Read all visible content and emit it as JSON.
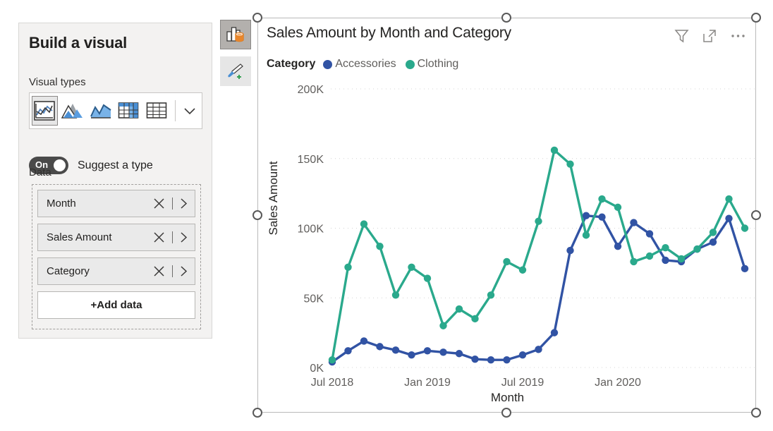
{
  "panel": {
    "title": "Build a visual",
    "visual_types_label": "Visual types",
    "data_label": "Data",
    "visual_types": [
      {
        "name": "line-chart",
        "selected": true
      },
      {
        "name": "area-chart",
        "selected": false
      },
      {
        "name": "line-and-area-chart",
        "selected": false
      },
      {
        "name": "matrix",
        "selected": false
      },
      {
        "name": "table",
        "selected": false
      }
    ],
    "more_types_label": "More visual types",
    "suggest": {
      "state_label": "On",
      "label": "Suggest a type",
      "enabled": true
    },
    "fields": [
      {
        "name": "Month"
      },
      {
        "name": "Sales Amount"
      },
      {
        "name": "Category"
      }
    ],
    "add_data_label": "+Add data"
  },
  "toolbar": {
    "build_visual_label": "Build visual",
    "format_visual_label": "Format visual"
  },
  "visual": {
    "title": "Sales Amount by Month and Category",
    "actions": [
      {
        "name": "filter-icon"
      },
      {
        "name": "focus-mode-icon"
      },
      {
        "name": "more-options-icon"
      }
    ]
  },
  "colors": {
    "accessories": "#3153A4",
    "clothing": "#2AA98C",
    "gridline": "#d4d4d4",
    "axis_text": "#605e5c",
    "panel_bg": "#f3f2f1"
  },
  "chart_data": {
    "type": "line",
    "title": "Sales Amount by Month and Category",
    "xlabel": "Month",
    "ylabel": "Sales Amount",
    "legend_title": "Category",
    "legend_position": "top",
    "grid": true,
    "ylim": [
      0,
      200000
    ],
    "ytick_labels": [
      "0K",
      "50K",
      "100K",
      "150K",
      "200K"
    ],
    "ytick_values": [
      0,
      50000,
      100000,
      150000,
      200000
    ],
    "xtick_labels": [
      "Jul 2018",
      "Jan 2019",
      "Jul 2019",
      "Jan 2020"
    ],
    "xtick_indices": [
      0,
      6,
      12,
      18
    ],
    "x": [
      "Jul 2018",
      "Aug 2018",
      "Sep 2018",
      "Oct 2018",
      "Nov 2018",
      "Dec 2018",
      "Jan 2019",
      "Feb 2019",
      "Mar 2019",
      "Apr 2019",
      "May 2019",
      "Jun 2019",
      "Jul 2019",
      "Aug 2019",
      "Sep 2019",
      "Oct 2019",
      "Nov 2019",
      "Dec 2019",
      "Jan 2020",
      "Feb 2020",
      "Mar 2020",
      "Apr 2020"
    ],
    "series": [
      {
        "name": "Accessories",
        "color": "#3153A4",
        "values": [
          4000,
          12000,
          19000,
          15000,
          12500,
          9000,
          12000,
          11000,
          10000,
          6000,
          5500,
          5500,
          9000,
          13000,
          25000,
          84000,
          109000,
          108000,
          87000,
          104000,
          96000,
          77000
        ]
      },
      {
        "name": "Clothing",
        "color": "#2AA98C",
        "values": [
          5500,
          72000,
          103000,
          87000,
          52000,
          72000,
          64000,
          30000,
          42000,
          35000,
          52000,
          76000,
          70000,
          105000,
          156000,
          146000,
          95000,
          121000,
          115000,
          76000,
          80000,
          86000
        ]
      }
    ],
    "series_tail": {
      "note": "continuation points for both series beyond Apr 2020",
      "Accessories": [
        76000,
        85000,
        90000,
        107000,
        71000
      ],
      "Clothing": [
        78000,
        85000,
        97000,
        121000,
        100000
      ]
    }
  }
}
